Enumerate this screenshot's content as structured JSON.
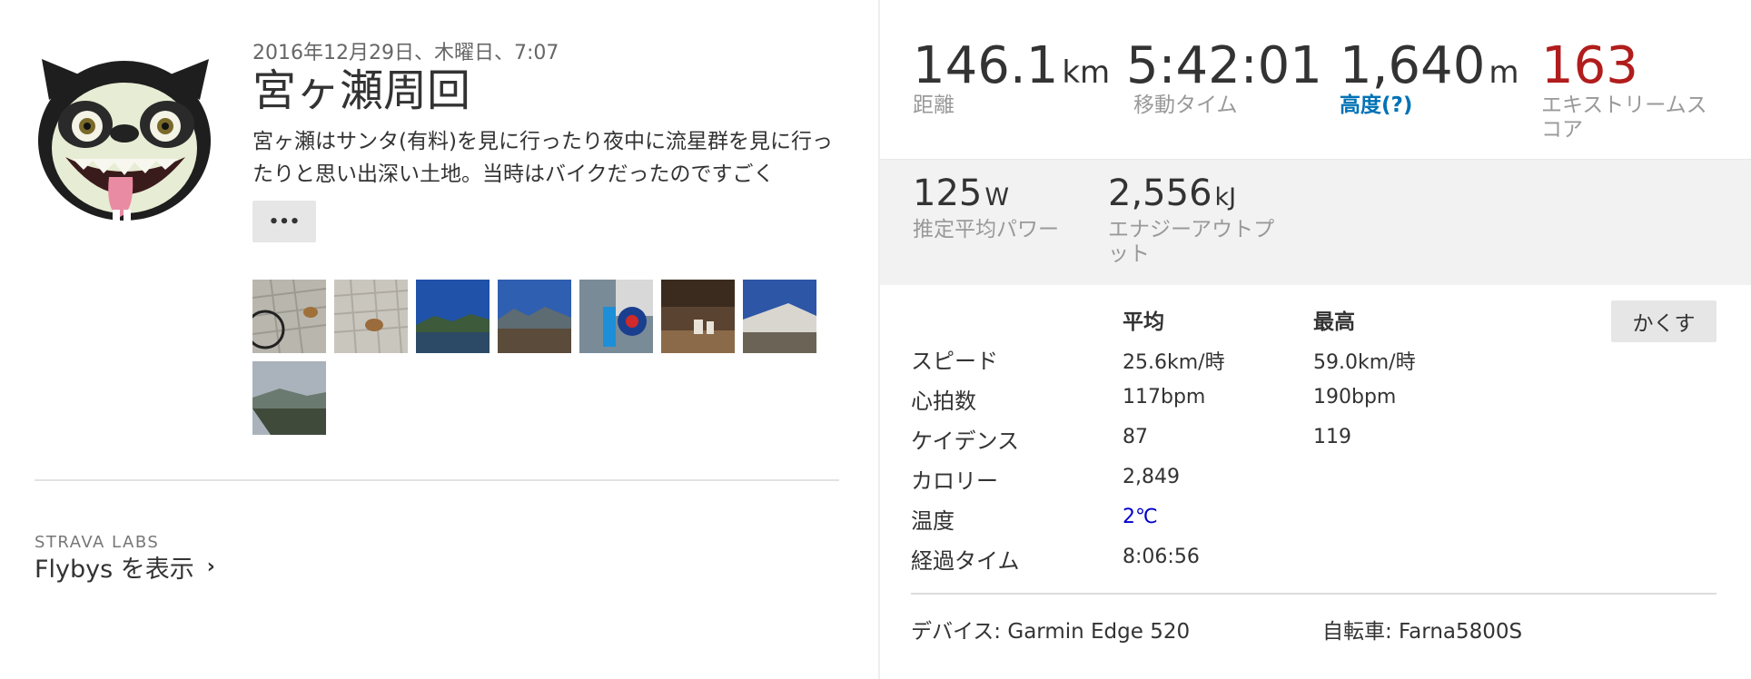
{
  "activity": {
    "date": "2016年12月29日、木曜日、7:07",
    "title": "宮ヶ瀬周回",
    "description": "宮ヶ瀬はサンタ(有料)を見に行ったり夜中に流星群を見に行ったりと思い出深い土地。当時はバイクだったのですごく",
    "more_label": "•••"
  },
  "avatar": {
    "icon": "cartoon-creature-avatar"
  },
  "photos": [
    {
      "name": "photo-sidewalk-bicycle",
      "colors": [
        "#b9b6ae",
        "#8e8c86"
      ]
    },
    {
      "name": "photo-sidewalk-object",
      "colors": [
        "#c9c6be",
        "#a9a59d"
      ]
    },
    {
      "name": "photo-lake-blue-sky",
      "colors": [
        "#1f52a8",
        "#3a5b6f"
      ]
    },
    {
      "name": "photo-mountain-field",
      "colors": [
        "#2f5fb0",
        "#5a4b3a"
      ]
    },
    {
      "name": "photo-drink-can",
      "colors": [
        "#2b6fc0",
        "#7a8b98"
      ]
    },
    {
      "name": "photo-cafe-interior",
      "colors": [
        "#5a4330",
        "#8b6a4a"
      ]
    },
    {
      "name": "photo-building-sky",
      "colors": [
        "#2d56a6",
        "#6b6355"
      ]
    },
    {
      "name": "photo-lake-view",
      "colors": [
        "#aab3bb",
        "#3f4a3a"
      ]
    }
  ],
  "labs": {
    "label": "STRAVA LABS",
    "link": "Flybys を表示",
    "chevron": "›"
  },
  "stats_primary": [
    {
      "value": "146.1",
      "unit": "km",
      "label": "距離"
    },
    {
      "value": "5:42:01",
      "unit": "",
      "label": "移動タイム"
    },
    {
      "value": "1,640",
      "unit": "m",
      "label": "高度(?)"
    },
    {
      "value": "163",
      "unit": "",
      "label": "エキストリームスコア"
    }
  ],
  "stats_secondary": [
    {
      "value": "125",
      "unit": "W",
      "label": "推定平均パワー"
    },
    {
      "value": "2,556",
      "unit": "kJ",
      "label": "エナジーアウトプット"
    }
  ],
  "details": {
    "headers": {
      "avg": "平均",
      "max": "最高"
    },
    "hide_button": "かくす",
    "rows": [
      {
        "label": "スピード",
        "avg": "25.6km/時",
        "max": "59.0km/時"
      },
      {
        "label": "心拍数",
        "avg": "117bpm",
        "max": "190bpm"
      },
      {
        "label": "ケイデンス",
        "avg": "87",
        "max": "119"
      },
      {
        "label": "カロリー",
        "avg": "2,849",
        "max": ""
      },
      {
        "label": "温度",
        "avg": "2℃",
        "max": ""
      },
      {
        "label": "経過タイム",
        "avg": "8:06:56",
        "max": ""
      }
    ]
  },
  "equipment": {
    "device": "デバイス: Garmin Edge 520",
    "bike": "自転車: Farna5800S"
  },
  "colors": {
    "extreme_score": "#b11c1c",
    "link_blue": "#0072b5",
    "temperature_blue": "#0000cc"
  }
}
